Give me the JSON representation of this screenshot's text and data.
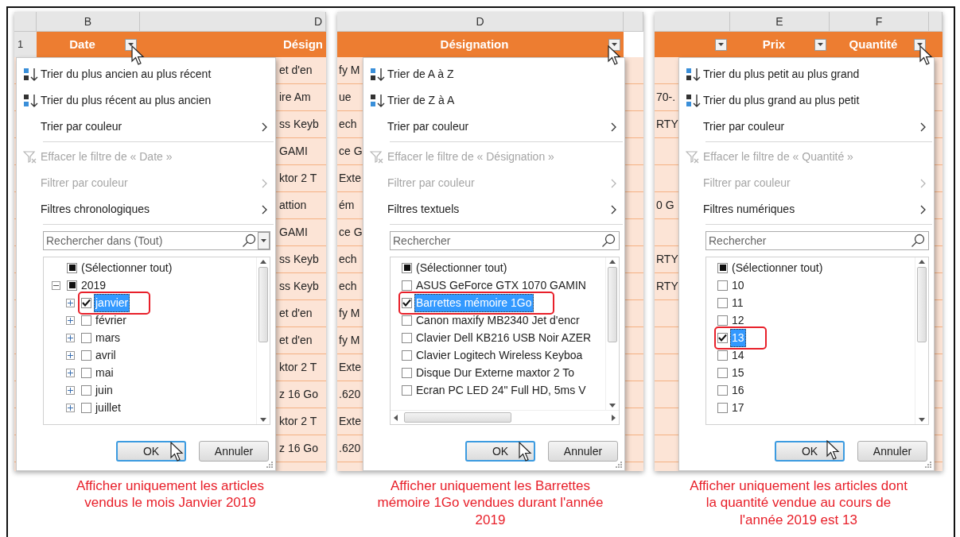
{
  "panels": [
    {
      "sheet": {
        "column_letters": [
          "B",
          "D"
        ],
        "row_number": "1",
        "headers": [
          {
            "label": "Date",
            "filter_button": true
          },
          {
            "label": "Désign",
            "filter_button": false
          }
        ],
        "cell_fragments": [
          "et d'en",
          "ire Am",
          "ss Keyb",
          "GAMI",
          "ktor 2 T",
          "attion",
          "GAMI",
          "ss Keyb",
          "ss Keyb",
          "et d'en",
          "et d'en",
          "ktor 2 T",
          "z 16 Go",
          "ktor 2 T",
          "z 16 Go"
        ]
      },
      "menu": {
        "items": [
          {
            "kind": "sort_asc",
            "label": "Trier du plus ancien au plus récent",
            "disabled": false
          },
          {
            "kind": "sort_desc",
            "label": "Trier du plus récent au plus ancien",
            "disabled": false
          },
          {
            "kind": "submenu",
            "label": "Trier par couleur",
            "disabled": false
          },
          {
            "kind": "clear_filter",
            "label": "Effacer le filtre de « Date »",
            "disabled": true
          },
          {
            "kind": "submenu",
            "label": "Filtrer par couleur",
            "disabled": true
          },
          {
            "kind": "submenu",
            "label": "Filtres chronologiques",
            "disabled": false
          }
        ],
        "search": {
          "placeholder": "Rechercher dans (Tout)",
          "dropdown": true
        },
        "values": [
          {
            "label": "(Sélectionner tout)",
            "checked": true,
            "partial": true,
            "selected": false,
            "highlighted": false
          },
          {
            "label": "2019",
            "checked": true,
            "partial": true,
            "expanded": true,
            "selected": false,
            "highlighted": false,
            "children": [
              {
                "label": "janvier",
                "checked": true,
                "expanded": false,
                "selected": true,
                "highlighted": true
              },
              {
                "label": "février",
                "checked": false,
                "expanded": false,
                "selected": false,
                "highlighted": false
              },
              {
                "label": "mars",
                "checked": false,
                "expanded": false,
                "selected": false,
                "highlighted": false
              },
              {
                "label": "avril",
                "checked": false,
                "expanded": false,
                "selected": false,
                "highlighted": false
              },
              {
                "label": "mai",
                "checked": false,
                "expanded": false,
                "selected": false,
                "highlighted": false
              },
              {
                "label": "juin",
                "checked": false,
                "expanded": false,
                "selected": false,
                "highlighted": false
              },
              {
                "label": "juillet",
                "checked": false,
                "expanded": false,
                "selected": false,
                "highlighted": false
              }
            ]
          }
        ],
        "horizontal_scrollbar": false,
        "buttons": [
          {
            "label": "OK",
            "default": true
          },
          {
            "label": "Annuler",
            "default": false
          }
        ]
      },
      "caption": "Afficher uniquement les articles vendus le mois Janvier 2019"
    },
    {
      "sheet": {
        "column_letters": [
          "D"
        ],
        "headers": [
          {
            "label": "Désignation",
            "filter_button": true
          }
        ],
        "cell_fragments": [
          "fy M",
          "ue",
          "ech",
          "ce G",
          "Exte",
          "ém",
          "ce G",
          "ech",
          "ech",
          "fy M",
          "fy M",
          "Exte",
          ".620",
          "Exte",
          ".620"
        ]
      },
      "menu": {
        "items": [
          {
            "kind": "sort_asc",
            "label": "Trier de A à Z",
            "disabled": false
          },
          {
            "kind": "sort_desc",
            "label": "Trier de Z à A",
            "disabled": false
          },
          {
            "kind": "submenu",
            "label": "Trier par couleur",
            "disabled": false
          },
          {
            "kind": "clear_filter",
            "label": "Effacer le filtre de « Désignation »",
            "disabled": true
          },
          {
            "kind": "submenu",
            "label": "Filtrer par couleur",
            "disabled": true
          },
          {
            "kind": "submenu",
            "label": "Filtres textuels",
            "disabled": false
          }
        ],
        "search": {
          "placeholder": "Rechercher",
          "dropdown": false
        },
        "values": [
          {
            "label": "(Sélectionner tout)",
            "checked": true,
            "partial": true,
            "selected": false,
            "highlighted": false
          },
          {
            "label": "ASUS GeForce GTX 1070 GAMIN",
            "checked": false,
            "selected": false,
            "highlighted": false
          },
          {
            "label": "Barrettes mémoire 1Go",
            "checked": true,
            "selected": true,
            "highlighted": true
          },
          {
            "label": "Canon maxify MB2340 Jet d'encr",
            "checked": false,
            "selected": false,
            "highlighted": false
          },
          {
            "label": "Clavier Dell KB216 USB Noir AZER",
            "checked": false,
            "selected": false,
            "highlighted": false
          },
          {
            "label": "Clavier Logitech Wireless Keyboa",
            "checked": false,
            "selected": false,
            "highlighted": false
          },
          {
            "label": "Disque Dur Externe maxtor 2 To",
            "checked": false,
            "selected": false,
            "highlighted": false
          },
          {
            "label": "Ecran PC LED 24\" Full HD, 5ms V",
            "checked": false,
            "selected": false,
            "highlighted": false
          }
        ],
        "horizontal_scrollbar": true,
        "buttons": [
          {
            "label": "OK",
            "default": true
          },
          {
            "label": "Annuler",
            "default": false
          }
        ]
      },
      "caption": "Afficher uniquement les Barrettes mémoire 1Go vendues durant l'année 2019"
    },
    {
      "sheet": {
        "column_letters": [
          "E",
          "F"
        ],
        "headers": [
          {
            "filter_button": true
          },
          {
            "label": "Prix",
            "filter_button": true
          },
          {
            "label": "Quantité",
            "filter_button": true
          }
        ],
        "cell_fragments": [
          "70-.",
          "RTY",
          "0 G",
          "RTY",
          "RTY"
        ]
      },
      "menu": {
        "items": [
          {
            "kind": "sort_asc",
            "label": "Trier du plus petit au plus grand",
            "disabled": false
          },
          {
            "kind": "sort_desc",
            "label": "Trier du plus grand au plus petit",
            "disabled": false
          },
          {
            "kind": "submenu",
            "label": "Trier par couleur",
            "disabled": false
          },
          {
            "kind": "clear_filter",
            "label": "Effacer le filtre de « Quantité »",
            "disabled": true
          },
          {
            "kind": "submenu",
            "label": "Filtrer par couleur",
            "disabled": true
          },
          {
            "kind": "submenu",
            "label": "Filtres numériques",
            "disabled": false
          }
        ],
        "search": {
          "placeholder": "Rechercher",
          "dropdown": false
        },
        "values": [
          {
            "label": "(Sélectionner tout)",
            "checked": true,
            "partial": true,
            "selected": false,
            "highlighted": false
          },
          {
            "label": "10",
            "checked": false,
            "selected": false,
            "highlighted": false
          },
          {
            "label": "11",
            "checked": false,
            "selected": false,
            "highlighted": false
          },
          {
            "label": "12",
            "checked": false,
            "selected": false,
            "highlighted": false
          },
          {
            "label": "13",
            "checked": true,
            "selected": true,
            "highlighted": true
          },
          {
            "label": "14",
            "checked": false,
            "selected": false,
            "highlighted": false
          },
          {
            "label": "15",
            "checked": false,
            "selected": false,
            "highlighted": false
          },
          {
            "label": "16",
            "checked": false,
            "selected": false,
            "highlighted": false
          },
          {
            "label": "17",
            "checked": false,
            "selected": false,
            "highlighted": false
          }
        ],
        "horizontal_scrollbar": false,
        "buttons": [
          {
            "label": "OK",
            "default": true
          },
          {
            "label": "Annuler",
            "default": false
          }
        ]
      },
      "caption": "Afficher uniquement les articles dont la quantité vendue au cours de l'année 2019 est 13"
    }
  ]
}
